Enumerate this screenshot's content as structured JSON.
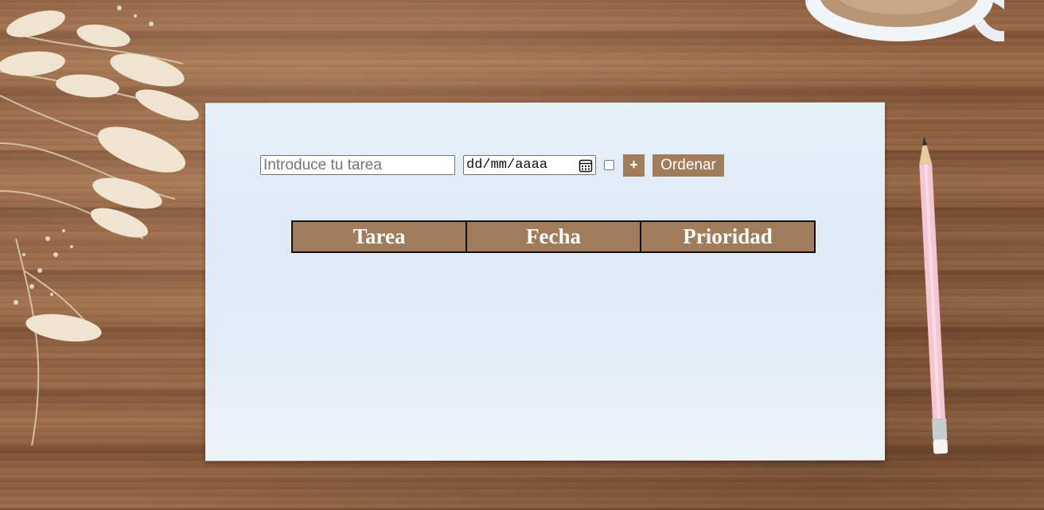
{
  "form": {
    "task_placeholder": "Introduce tu tarea",
    "date_value": "dd/mm/aaaa",
    "priority_checked": false,
    "add_label": "+",
    "sort_label": "Ordenar"
  },
  "table": {
    "headers": [
      "Tarea",
      "Fecha",
      "Prioridad"
    ],
    "rows": []
  },
  "colors": {
    "accent": "#a07c5b",
    "paper": "#e3ecf6",
    "wood": "#8e5e3d"
  },
  "icons": {
    "date_picker": "calendar-icon"
  }
}
